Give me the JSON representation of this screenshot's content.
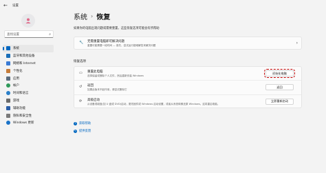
{
  "window": {
    "title": "设置"
  },
  "sidebar": {
    "search_placeholder": "查找设置",
    "items": [
      {
        "label": "系统",
        "icon": "system-icon",
        "color": "#0067c0",
        "active": true
      },
      {
        "label": "蓝牙和其他设备",
        "icon": "bluetooth-icon",
        "color": "#1b6fb8"
      },
      {
        "label": "网络和 Internet",
        "icon": "network-icon",
        "color": "#3a7bd5"
      },
      {
        "label": "个性化",
        "icon": "personalization-icon",
        "color": "#c57c3a"
      },
      {
        "label": "应用",
        "icon": "apps-icon",
        "color": "#5a6c7e"
      },
      {
        "label": "帐户",
        "icon": "accounts-icon",
        "color": "#2e9a5a"
      },
      {
        "label": "时间和语言",
        "icon": "time-language-icon",
        "color": "#2a7fc9"
      },
      {
        "label": "游戏",
        "icon": "gaming-icon",
        "color": "#6b6b6b"
      },
      {
        "label": "辅助功能",
        "icon": "accessibility-icon",
        "color": "#2b5fa8"
      },
      {
        "label": "隐私和安全性",
        "icon": "privacy-icon",
        "color": "#7a7a7a"
      },
      {
        "label": "Windows 更新",
        "icon": "windows-update-icon",
        "color": "#1a73c8"
      }
    ]
  },
  "main": {
    "breadcrumb_parent": "系统",
    "breadcrumb_current": "恢复",
    "subtitle": "如果你的电脑出现问题或需要重置，这些恢复选项可能会有所帮助",
    "troubleshoot": {
      "title": "无需重置电脑即可解决问题",
      "desc": "重置可能需要一段时间 — 首先，尝试运行疑难解答来解决问题"
    },
    "section_label": "恢复选项",
    "options": [
      {
        "title": "重置此电脑",
        "desc": "选择保留或删除个人文件，然后重新安装 Windows",
        "button": "初始化电脑",
        "icon": "reset-icon",
        "highlight": true
      },
      {
        "title": "返回",
        "desc": "如果此版本不起作用，请尝试删除它",
        "button": "返回",
        "icon": "go-back-icon",
        "highlight": false
      },
      {
        "title": "高级启动",
        "desc": "从设备或磁盘(如 U 盘或 DVD)启动，更改固件或 Windows 启动设置，或者从系统映像还原 Windows。这将重启电脑。",
        "button": "立即重新启动",
        "icon": "advanced-startup-icon",
        "highlight": false
      }
    ],
    "help_links": [
      "获取帮助",
      "提供反馈"
    ]
  }
}
